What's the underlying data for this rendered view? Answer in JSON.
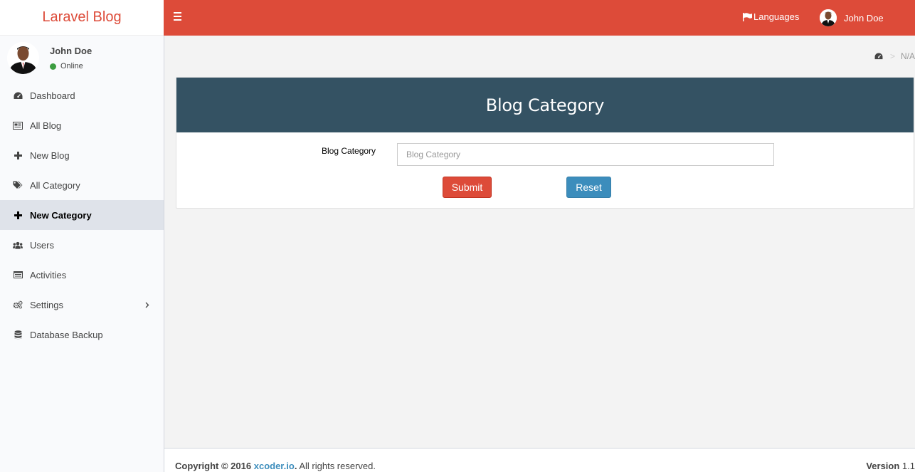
{
  "brand": {
    "title": "Laravel Blog",
    "color": "#dd4b39"
  },
  "navbar": {
    "toggle_icon": "hamburger-icon",
    "languages_label": "Languages",
    "user_name": "John Doe",
    "color": "#dd4b39"
  },
  "sidebar": {
    "user": {
      "name": "John Doe",
      "status": "Online"
    },
    "items": [
      {
        "label": "Dashboard",
        "icon": "dashboard-icon"
      },
      {
        "label": "All Blog",
        "icon": "newspaper-icon"
      },
      {
        "label": "New Blog",
        "icon": "plus-icon"
      },
      {
        "label": "All Category",
        "icon": "tags-icon"
      },
      {
        "label": "New Category",
        "icon": "plus-icon",
        "active": true
      },
      {
        "label": "Users",
        "icon": "users-icon"
      },
      {
        "label": "Activities",
        "icon": "list-icon"
      },
      {
        "label": "Settings",
        "icon": "gears-icon",
        "has_submenu": true
      },
      {
        "label": "Database Backup",
        "icon": "database-icon"
      }
    ]
  },
  "breadcrumb": {
    "icon": "dashboard-icon",
    "current": "N/A"
  },
  "form": {
    "header": "Blog Category",
    "header_color": "#345263",
    "field_label": "Blog Category",
    "field_placeholder": "Blog Category",
    "field_value": "",
    "submit_label": "Submit",
    "reset_label": "Reset"
  },
  "footer": {
    "copyright_prefix": "Copyright © 2016",
    "company": "xcoder.io",
    "suffix": "All rights reserved.",
    "version_label": "Version",
    "version": "1.1"
  }
}
